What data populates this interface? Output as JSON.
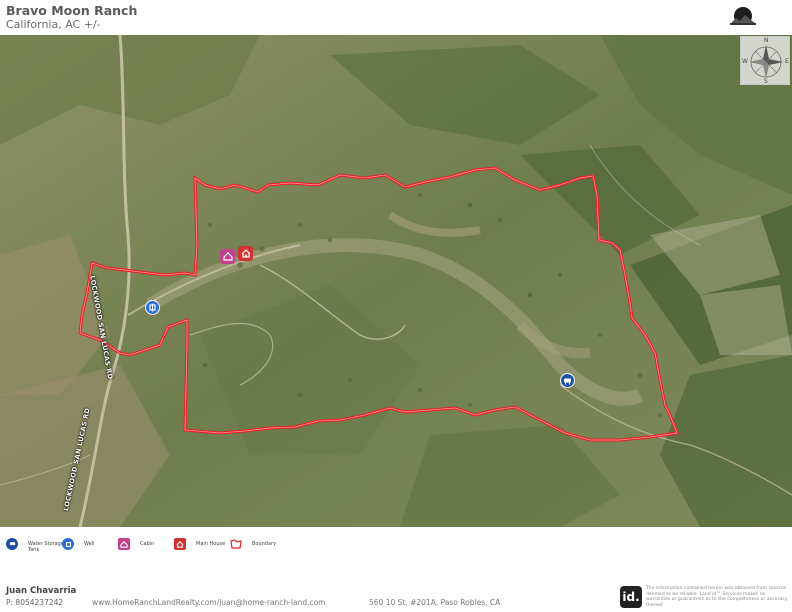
{
  "header": {
    "title": "Bravo Moon Ranch",
    "subtitle": "California,  AC +/-"
  },
  "compass": {
    "n": "N",
    "s": "S",
    "e": "E",
    "w": "W"
  },
  "colors": {
    "boundary": "#e8232a",
    "water_storage": "#1f4fa8",
    "well": "#2c6fd6",
    "cabin": "#c2418f",
    "main_house": "#d13232"
  },
  "map": {
    "road_labels": [
      "LOCKWOOD SAN LUCAS RD",
      "LOCKWOOD SAN LUCAS RD"
    ],
    "markers": [
      {
        "type": "cabin",
        "icon": "cabin-icon"
      },
      {
        "type": "main_house",
        "icon": "house-icon"
      },
      {
        "type": "well",
        "icon": "well-icon"
      },
      {
        "type": "water_storage",
        "icon": "water-tank-icon"
      }
    ]
  },
  "legend": [
    {
      "label": "Water Storage Tank",
      "icon": "water-tank-icon"
    },
    {
      "label": "Well",
      "icon": "well-icon"
    },
    {
      "label": "Cabin",
      "icon": "cabin-icon"
    },
    {
      "label": "Main House",
      "icon": "house-icon"
    },
    {
      "label": "Boundary",
      "icon": "boundary-icon"
    }
  ],
  "footer": {
    "agent_name": "Juan Chavarria",
    "phone": "P: 8054237242",
    "website": "www.HomeRanchLandRealty.com/juan@home-ranch-land.com",
    "address": "560 10 St. #201A, Paso Robles, CA",
    "logo_text": "id.",
    "disclaimer": "The information contained herein was obtained from sources deemed to be reliable. Land id™ Services makes no warranties or guarantees as to the completeness or accuracy thereof."
  }
}
